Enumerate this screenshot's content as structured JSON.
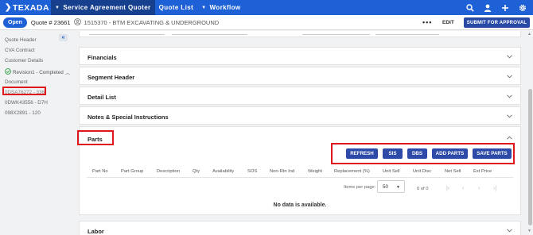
{
  "app": {
    "logo": "TEXADA",
    "nav": [
      {
        "label": "Service Agreement Quoter"
      },
      {
        "label": "Quote List"
      },
      {
        "label": "Workflow"
      }
    ]
  },
  "subheader": {
    "status": "Open",
    "quote_number": "Quote # 23661",
    "account": "1515370 - BTM EXCAVATING & UNDERGROUND",
    "more": "•••",
    "edit": "EDIT",
    "submit": "SUBMIT FOR APPROVAL"
  },
  "sidebar": {
    "collapse": "«",
    "items": [
      "Quote Header",
      "CVA Contract",
      "Customer Details"
    ],
    "revision": "Revision1 - Completed",
    "document": "Document",
    "documents": [
      "0DSA76272 - 336",
      "0DWK43556 - D7H",
      "098X2891 - 120"
    ]
  },
  "sections": {
    "financials": "Financials",
    "segment_header": "Segment Header",
    "detail_list": "Detail List",
    "notes": "Notes & Special Instructions",
    "parts": "Parts",
    "labor": "Labor"
  },
  "parts": {
    "buttons": [
      "REFRESH",
      "SIS",
      "DBS",
      "ADD PARTS",
      "SAVE PARTS"
    ],
    "columns": [
      "Part No",
      "Part Group",
      "Description",
      "Qty",
      "Availability",
      "SOS",
      "Non-Rtn Ind",
      "Weight",
      "Replacement (%)",
      "Unit Sell",
      "Unit Disc",
      "Net Sell",
      "Ext Price"
    ],
    "items_per_page_label": "Items per page:",
    "items_per_page": "50",
    "range": "0 of 0",
    "no_data": "No data is available."
  },
  "colors": {
    "primary": "#1e60d5",
    "nav_active": "#163f8e",
    "button": "#2d4aa8",
    "highlight": "#e0161d"
  }
}
